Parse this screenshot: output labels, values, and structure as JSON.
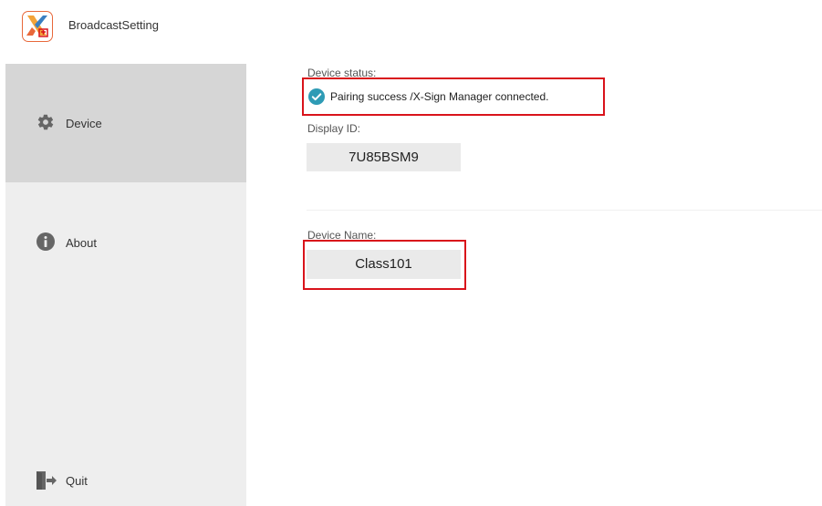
{
  "app": {
    "title": "BroadcastSetting",
    "logo_icon": "x-sign-logo-icon",
    "logo_color": "#e8683a"
  },
  "sidebar": {
    "items": [
      {
        "label": "Device",
        "icon": "gear-icon",
        "active": true
      },
      {
        "label": "About",
        "icon": "info-icon",
        "active": false
      }
    ],
    "quit": {
      "label": "Quit",
      "icon": "exit-icon"
    }
  },
  "main": {
    "device_status_label": "Device status:",
    "device_status_text": "Pairing success /X-Sign Manager connected.",
    "status_icon": "check-circle-icon",
    "status_icon_color": "#2e9bb5",
    "display_id_label": "Display ID:",
    "display_id_value": "7U85BSM9",
    "device_name_label": "Device Name:",
    "device_name_value": "Class101",
    "highlight_color": "#d9131b"
  }
}
